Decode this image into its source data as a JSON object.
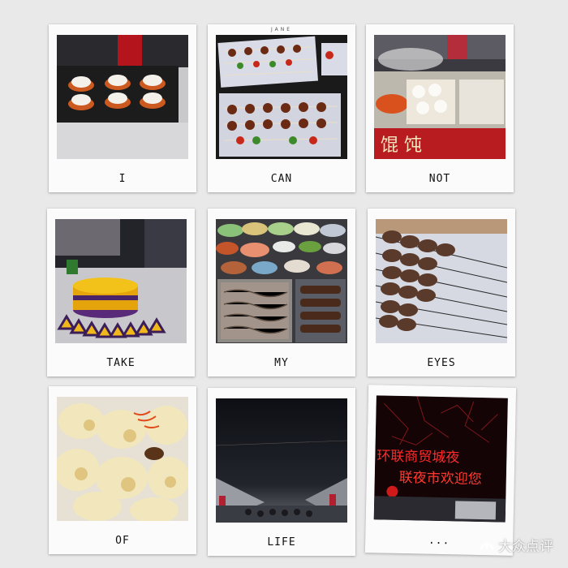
{
  "top_label": "JANE",
  "polaroids": [
    {
      "caption": "I",
      "photo": "grill-pots-icon"
    },
    {
      "caption": "CAN",
      "photo": "skewers-tray-icon"
    },
    {
      "caption": "NOT",
      "photo": "dumpling-stall-icon"
    },
    {
      "caption": "TAKE",
      "photo": "layer-cake-icon"
    },
    {
      "caption": "MY",
      "photo": "food-buffet-icon"
    },
    {
      "caption": "EYES",
      "photo": "meat-skewers-icon"
    },
    {
      "caption": "OF",
      "photo": "fried-dish-icon"
    },
    {
      "caption": "LIFE",
      "photo": "night-sky-icon"
    },
    {
      "caption": "...",
      "photo": "neon-sign-icon"
    }
  ],
  "sign_text": {
    "stall": "馄 饨",
    "neon_top": "环联商贸城夜",
    "neon_bottom": "联夜市欢迎您"
  },
  "watermark": "大众点评",
  "colors": {
    "background": "#e9e9e9",
    "frame": "#fbfbfb",
    "neon_red": "#ff2a2a"
  }
}
